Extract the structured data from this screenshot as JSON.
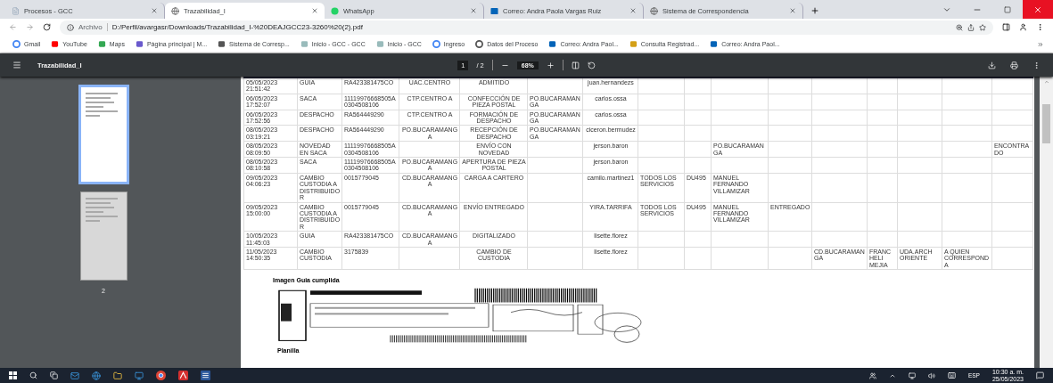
{
  "tabs": [
    {
      "title": "Procesos - GCC",
      "selected": false
    },
    {
      "title": "Trazabilidad_I",
      "selected": true
    },
    {
      "title": "WhatsApp",
      "selected": false
    },
    {
      "title": "Correo: Andra Paola Vargas Ruiz",
      "selected": false
    },
    {
      "title": "Sistema de Correspondencia",
      "selected": false
    }
  ],
  "address_bar": {
    "scheme": "Archivo",
    "url": "D:/Perfil/avargasr/Downloads/Trazabilidad_I-%20DEAJGCC23-3260%20(2).pdf"
  },
  "bookmarks": [
    "Gmail",
    "YouTube",
    "Maps",
    "Página principal | M...",
    "Sistema de Corresp...",
    "Inicio - GCC - GCC",
    "Inicio - GCC",
    "Ingreso",
    "Datos del Proceso",
    "Correo: Andra Paol...",
    "Consulta Registrad...",
    "Correo: Andra Paol..."
  ],
  "pdf_toolbar": {
    "title": "Trazabilidad_I",
    "page": "1",
    "page_total": "/ 2",
    "zoom": "68%"
  },
  "thumbnails": [
    {
      "selected": true
    },
    {
      "label": "2",
      "selected": false
    }
  ],
  "document": {
    "table": {
      "rows": [
        {
          "cells": [
            "05/05/2023 21:51:42",
            "GUIA",
            "RA423381475CO",
            "UAC.CENTRO",
            "ADMITIDO",
            null,
            "juan.hernandezs",
            null,
            null,
            null,
            null,
            null,
            null,
            null,
            null,
            null
          ]
        },
        {
          "cells": [
            "06/05/2023 17:52:07",
            "SACA",
            "11119976668505A0304508106",
            "CTP.CENTRO A",
            "CONFECCIÓN DE PIEZA POSTAL",
            "PO.BUCARAMANGA",
            "carlos.ossa",
            null,
            null,
            null,
            null,
            null,
            null,
            null,
            null,
            null
          ]
        },
        {
          "cells": [
            "06/05/2023 17:52:56",
            "DESPACHO",
            "RA564449290",
            "CTP.CENTRO A",
            "FORMACIÓN DE DESPACHO",
            "PO.BUCARAMANGA",
            "carlos.ossa",
            null,
            null,
            null,
            null,
            null,
            null,
            null,
            null,
            null
          ]
        },
        {
          "cells": [
            "08/05/2023 03:19:21",
            "DESPACHO",
            "RA564449290",
            "PO.BUCARAMANGA",
            "RECEPCIÓN DE DESPACHO",
            "PO.BUCARAMANGA",
            "ciceron.bermudez",
            null,
            null,
            null,
            null,
            null,
            null,
            null,
            null,
            null
          ]
        },
        {
          "cells": [
            "08/05/2023 08:09:50",
            "NOVEDAD EN SACA",
            "11119976668505A0304508106",
            null,
            "ENVÍO CON NOVEDAD",
            null,
            "jerson.baron",
            null,
            null,
            "PO.BUCARAMANGA",
            null,
            null,
            null,
            null,
            null,
            "ENCONTRADO"
          ]
        },
        {
          "cells": [
            "08/05/2023 08:10:58",
            "SACA",
            "11119976668505A0304508106",
            "PO.BUCARAMANGA",
            "APERTURA DE PIEZA POSTAL",
            null,
            "jerson.baron",
            null,
            null,
            null,
            null,
            null,
            null,
            null,
            null,
            null
          ]
        },
        {
          "cells": [
            "09/05/2023 04:06:23",
            "CAMBIO CUSTODIA A DISTRIBUIDOR",
            "0015779045",
            "CD.BUCARAMANGA",
            "CARGA A CARTERO",
            null,
            "camilo.martinez1",
            "TODOS LOS SERVICIOS",
            "DU495",
            "MANUEL FERNANDO VILLAMIZAR",
            null,
            null,
            null,
            null,
            null,
            null
          ]
        },
        {
          "cells": [
            "09/05/2023 15:00:00",
            "CAMBIO CUSTODIA A DISTRIBUIDOR",
            "0015779045",
            "CD.BUCARAMANGA",
            "ENVÍO ENTREGADO",
            null,
            "YIRA.TARRIFA",
            "TODOS LOS SERVICIOS",
            "DU495",
            "MANUEL FERNANDO VILLAMIZAR",
            "ENTREGADO",
            null,
            null,
            null,
            null,
            null
          ]
        },
        {
          "cells": [
            "10/05/2023 11:45:03",
            "GUIA",
            "RA423381475CO",
            "CD.BUCARAMANGA",
            "DIGITALIZADO",
            null,
            "lisette.florez",
            null,
            null,
            null,
            null,
            null,
            null,
            null,
            null,
            null
          ]
        },
        {
          "cells": [
            "11/05/2023 14:50:35",
            "CAMBIO CUSTODIA",
            "3175839",
            null,
            "CAMBIO DE CUSTODIA",
            null,
            "lisette.florez",
            null,
            null,
            null,
            null,
            "CD.BUCARAMANGA",
            "FRANC HELI MEJIA",
            "UDA.ARCH ORIENTE",
            "A QUIEN CORRESPONDA",
            null
          ]
        }
      ]
    },
    "image_caption": "Imagen Guia cumplida",
    "next_heading": "Planilla"
  },
  "taskbar": {
    "language": "ESP",
    "time": "10:30 a. m.",
    "date": "25/05/2023"
  }
}
